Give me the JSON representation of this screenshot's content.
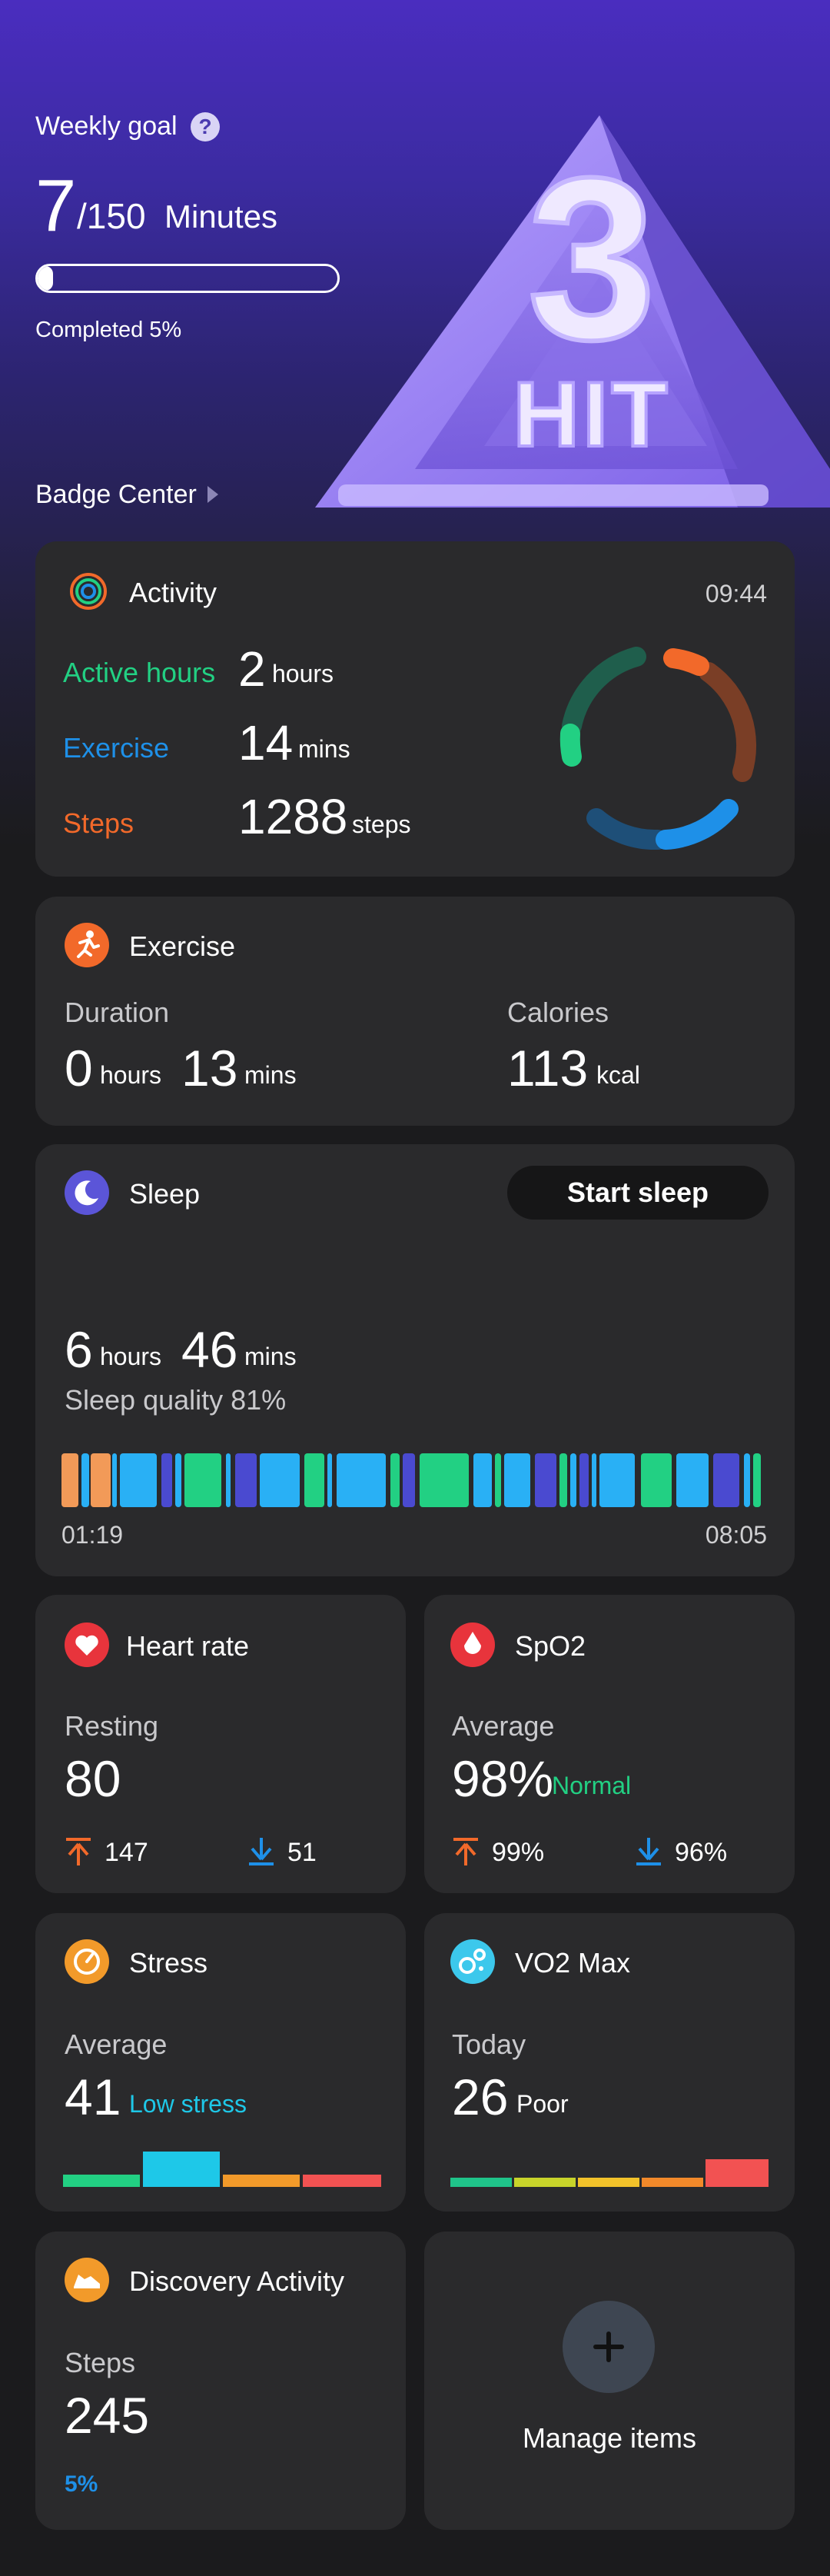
{
  "hero": {
    "goal_label": "Weekly goal",
    "help_glyph": "?",
    "goal_value": "7",
    "goal_total": "/150",
    "goal_unit": "Minutes",
    "progress_fraction": 0.05,
    "completed_text": "Completed 5%",
    "badge_center": "Badge Center",
    "badge_text": "3",
    "badge_subtext": "HIT"
  },
  "activity": {
    "title": "Activity",
    "time": "09:44",
    "rows": [
      {
        "label": "Active hours",
        "value": "2",
        "unit": "hours",
        "color": "#22d083"
      },
      {
        "label": "Exercise",
        "value": "14",
        "unit": "mins",
        "color": "#1e90e8"
      },
      {
        "label": "Steps",
        "value": "1288",
        "unit": "steps",
        "color": "#f2692a"
      }
    ]
  },
  "exercise": {
    "title": "Exercise",
    "duration_label": "Duration",
    "duration_hours": "0",
    "hours_unit": "hours",
    "duration_mins": "13",
    "mins_unit": "mins",
    "calories_label": "Calories",
    "calories_value": "113",
    "calories_unit": "kcal"
  },
  "sleep": {
    "title": "Sleep",
    "start_button": "Start sleep",
    "hours": "6",
    "hours_unit": "hours",
    "mins": "46",
    "mins_unit": "mins",
    "quality": "Sleep quality 81%",
    "start_time": "01:19",
    "end_time": "08:05"
  },
  "heart_rate": {
    "title": "Heart rate",
    "label": "Resting",
    "value": "80",
    "max": "147",
    "min": "51"
  },
  "spo2": {
    "title": "SpO2",
    "label": "Average",
    "value": "98%",
    "status": "Normal",
    "max": "99%",
    "min": "96%"
  },
  "stress": {
    "title": "Stress",
    "label": "Average",
    "value": "41",
    "status": "Low stress"
  },
  "vo2": {
    "title": "VO2 Max",
    "label": "Today",
    "value": "26",
    "status": "Poor"
  },
  "discovery": {
    "title": "Discovery Activity",
    "label": "Steps",
    "value": "245",
    "percent": "5%"
  },
  "manage": {
    "label": "Manage items"
  },
  "colors": {
    "card_bg": "#2a2a2c",
    "green": "#22d083",
    "blue": "#1e90e8",
    "orange": "#f2692a",
    "cyan": "#1ec8e8"
  }
}
